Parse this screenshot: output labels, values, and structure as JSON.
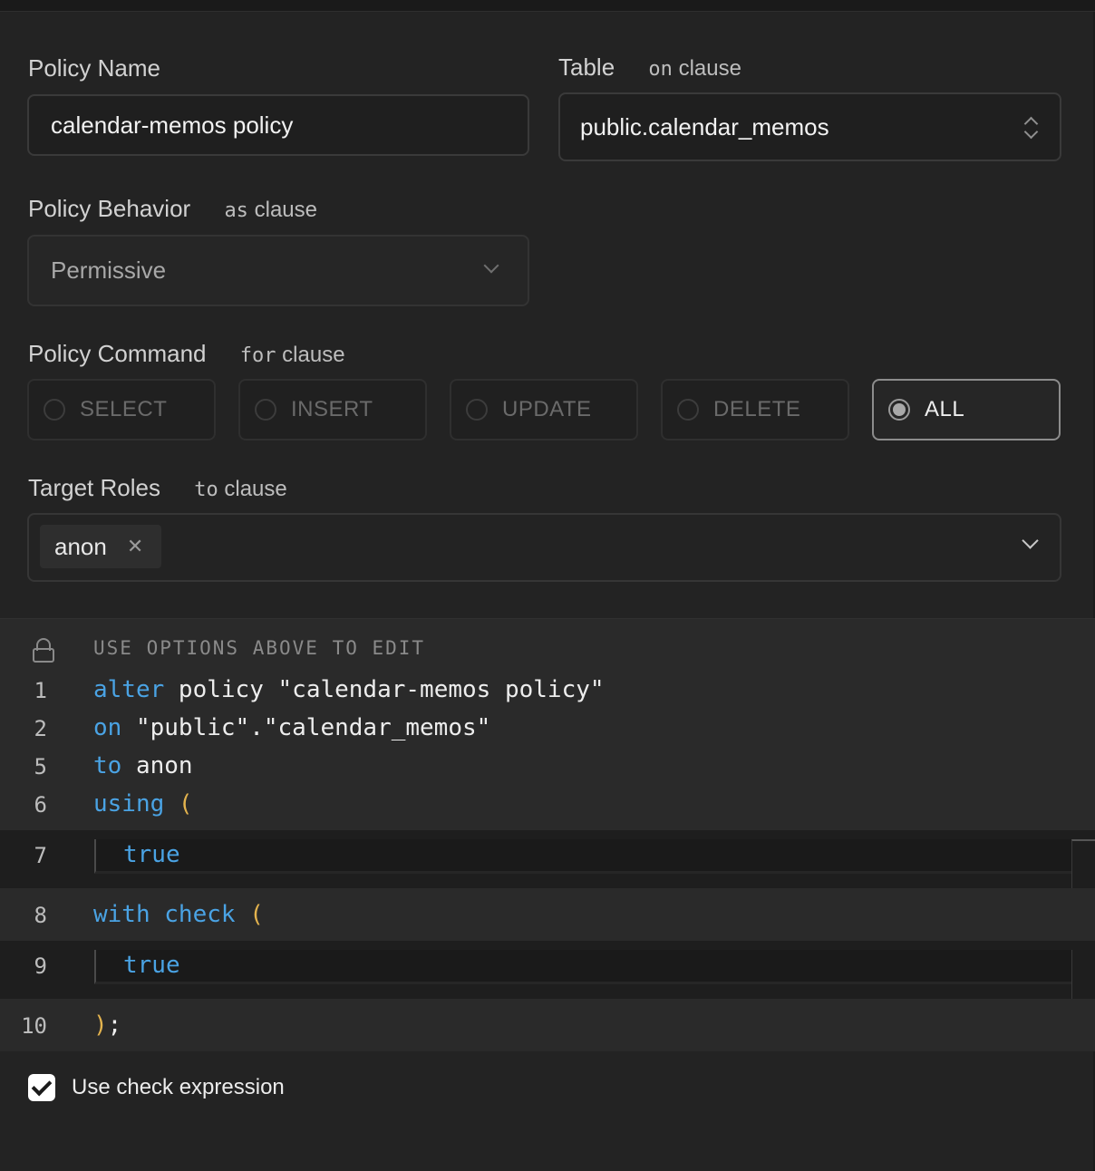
{
  "form": {
    "policy_name": {
      "label": "Policy Name",
      "value": "calendar-memos policy"
    },
    "table": {
      "label": "Table",
      "clause_kw": "on",
      "clause_word": "clause",
      "value": "public.calendar_memos"
    },
    "behavior": {
      "label": "Policy Behavior",
      "clause_kw": "as",
      "clause_word": "clause",
      "value": "Permissive"
    },
    "command": {
      "label": "Policy Command",
      "clause_kw": "for",
      "clause_word": "clause",
      "options": [
        "SELECT",
        "INSERT",
        "UPDATE",
        "DELETE",
        "ALL"
      ],
      "selected": "ALL"
    },
    "roles": {
      "label": "Target Roles",
      "clause_kw": "to",
      "clause_word": "clause",
      "chips": [
        "anon"
      ],
      "remove_glyph": "✕"
    }
  },
  "editor": {
    "hint": "USE OPTIONS ABOVE TO EDIT",
    "lines": [
      {
        "num": "1",
        "kw": "alter",
        "rest": " policy \"calendar-memos policy\""
      },
      {
        "num": "2",
        "kw": "on",
        "rest": " \"public\".\"calendar_memos\""
      },
      {
        "num": "5",
        "kw": "to",
        "rest": " anon"
      },
      {
        "num": "6",
        "kw": "using",
        "paren": " ("
      },
      {
        "num": "7",
        "value": "true"
      },
      {
        "num": "8",
        "kw": "with check",
        "paren": " ("
      },
      {
        "num": "9",
        "value": "true"
      },
      {
        "num": "10",
        "paren": ")",
        "rest": ";"
      }
    ]
  },
  "check_expression": {
    "label": "Use check expression",
    "checked": true
  },
  "colors": {
    "keyword": "#4aa3e4",
    "paren": "#e3b34e",
    "background": "#232323"
  }
}
